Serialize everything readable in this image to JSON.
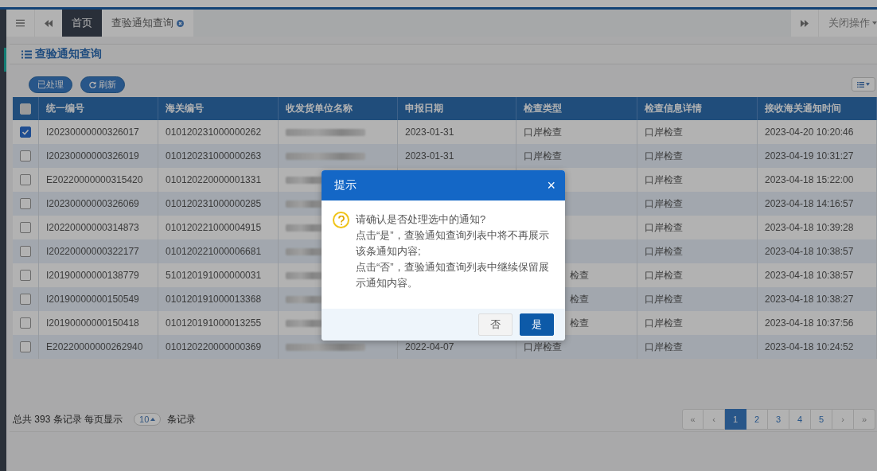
{
  "top_tabs": [
    {
      "label": "首页",
      "selected": true
    },
    {
      "label": "查验通知查询",
      "selected": false
    }
  ],
  "close_menu": "关闭操作",
  "page_title": "查验通知查询",
  "toolbar_buttons": [
    {
      "label": "已处理",
      "kind": "plain"
    },
    {
      "label": "刷新",
      "kind": "refresh"
    }
  ],
  "table": {
    "header_checked": false,
    "columns": [
      "统一编号",
      "海关编号",
      "收发货单位名称",
      "申报日期",
      "检查类型",
      "检查信息详情",
      "接收海关通知时间"
    ],
    "rows": [
      {
        "selected": true,
        "id": "I20230000000326017",
        "customs_no": "010120231000000262",
        "date": "2023-01-31",
        "check_type": "口岸检查",
        "detail": "口岸检查",
        "received": "2023-04-20 10:20:46"
      },
      {
        "selected": false,
        "id": "I20230000000326019",
        "customs_no": "010120231000000263",
        "date": "2023-01-31",
        "check_type": "口岸检查",
        "detail": "口岸检查",
        "received": "2023-04-19 10:31:27"
      },
      {
        "selected": false,
        "id": "E20220000000315420",
        "customs_no": "010120220000001331",
        "detail": "口岸检查",
        "received": "2023-04-18 15:22:00"
      },
      {
        "selected": false,
        "id": "I20230000000326069",
        "customs_no": "010120231000000285",
        "detail": "口岸检查",
        "received": "2023-04-18 14:16:57"
      },
      {
        "selected": false,
        "id": "I20220000000314873",
        "customs_no": "010120221000004915",
        "detail": "口岸检查",
        "received": "2023-04-18 10:39:28"
      },
      {
        "selected": false,
        "id": "I20220000000322177",
        "customs_no": "010120221000006681",
        "detail": "口岸检查",
        "received": "2023-04-18 10:38:57"
      },
      {
        "selected": false,
        "id": "I20190000000138779",
        "customs_no": "510120191000000031",
        "check_type": "检查",
        "detail": "口岸检查",
        "received": "2023-04-18 10:38:57"
      },
      {
        "selected": false,
        "id": "I20190000000150549",
        "customs_no": "010120191000013368",
        "check_type": "检查",
        "detail": "口岸检查",
        "received": "2023-04-18 10:38:27"
      },
      {
        "selected": false,
        "id": "I20190000000150418",
        "customs_no": "010120191000013255",
        "check_type": "检查",
        "detail": "口岸检查",
        "received": "2023-04-18 10:37:56"
      },
      {
        "selected": false,
        "id": "E20220000000262940",
        "customs_no": "010120220000000369",
        "date": "2022-04-07",
        "check_type": "口岸检查",
        "detail": "口岸检查",
        "received": "2023-04-18 10:24:52"
      }
    ]
  },
  "footer": {
    "total_text": "总共 393 条记录 每页显示",
    "page_size": "10",
    "suffix": "条记录"
  },
  "pagination": {
    "first": "«",
    "prev": "‹",
    "next": "›",
    "last": "»",
    "pages": [
      {
        "label": "1",
        "selected": true
      },
      {
        "label": "2",
        "selected": false
      },
      {
        "label": "3",
        "selected": false
      },
      {
        "label": "4",
        "selected": false
      },
      {
        "label": "5",
        "selected": false
      }
    ]
  },
  "dialog": {
    "title": "提示",
    "close": "×",
    "paragraphs": [
      "请确认是否处理选中的通知?",
      "点击“是”，查验通知查询列表中将不再展示该条通知内容;",
      "点击“否”，查验通知查询列表中继续保留展示通知内容。"
    ],
    "buttons": [
      {
        "label": "否",
        "kind": "secondary"
      },
      {
        "label": "是",
        "kind": "primary"
      }
    ]
  }
}
